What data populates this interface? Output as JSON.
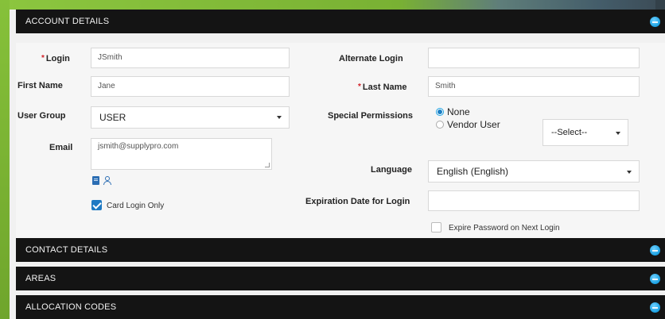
{
  "sections": {
    "account": "ACCOUNT DETAILS",
    "contact": "CONTACT DETAILS",
    "areas": "AREAS",
    "allocation": "ALLOCATION CODES"
  },
  "form": {
    "login_label": "Login",
    "login_value": "JSmith",
    "first_name_label": "First Name",
    "first_name_value": "Jane",
    "user_group_label": "User Group",
    "user_group_value": "USER",
    "email_label": "Email",
    "email_value": "jsmith@supplypro.com",
    "card_login_label": "Card Login Only",
    "alternate_login_label": "Alternate Login",
    "alternate_login_value": "",
    "last_name_label": "Last Name",
    "last_name_value": "Smith",
    "special_permissions_label": "Special Permissions",
    "perm_none": "None",
    "perm_vendor": "Vendor User",
    "vendor_select_value": "--Select--",
    "language_label": "Language",
    "language_value": "English (English)",
    "expiration_label": "Expiration Date for Login",
    "expiration_value": "",
    "expire_password_label": "Expire Password on Next Login"
  },
  "state": {
    "card_login_only": true,
    "special_permission_selected": "None",
    "expire_password": false
  },
  "colors": {
    "header_bg": "#141414",
    "accent": "#1ba1e2",
    "required": "#d21f26",
    "checkbox": "#1f7ac3"
  }
}
